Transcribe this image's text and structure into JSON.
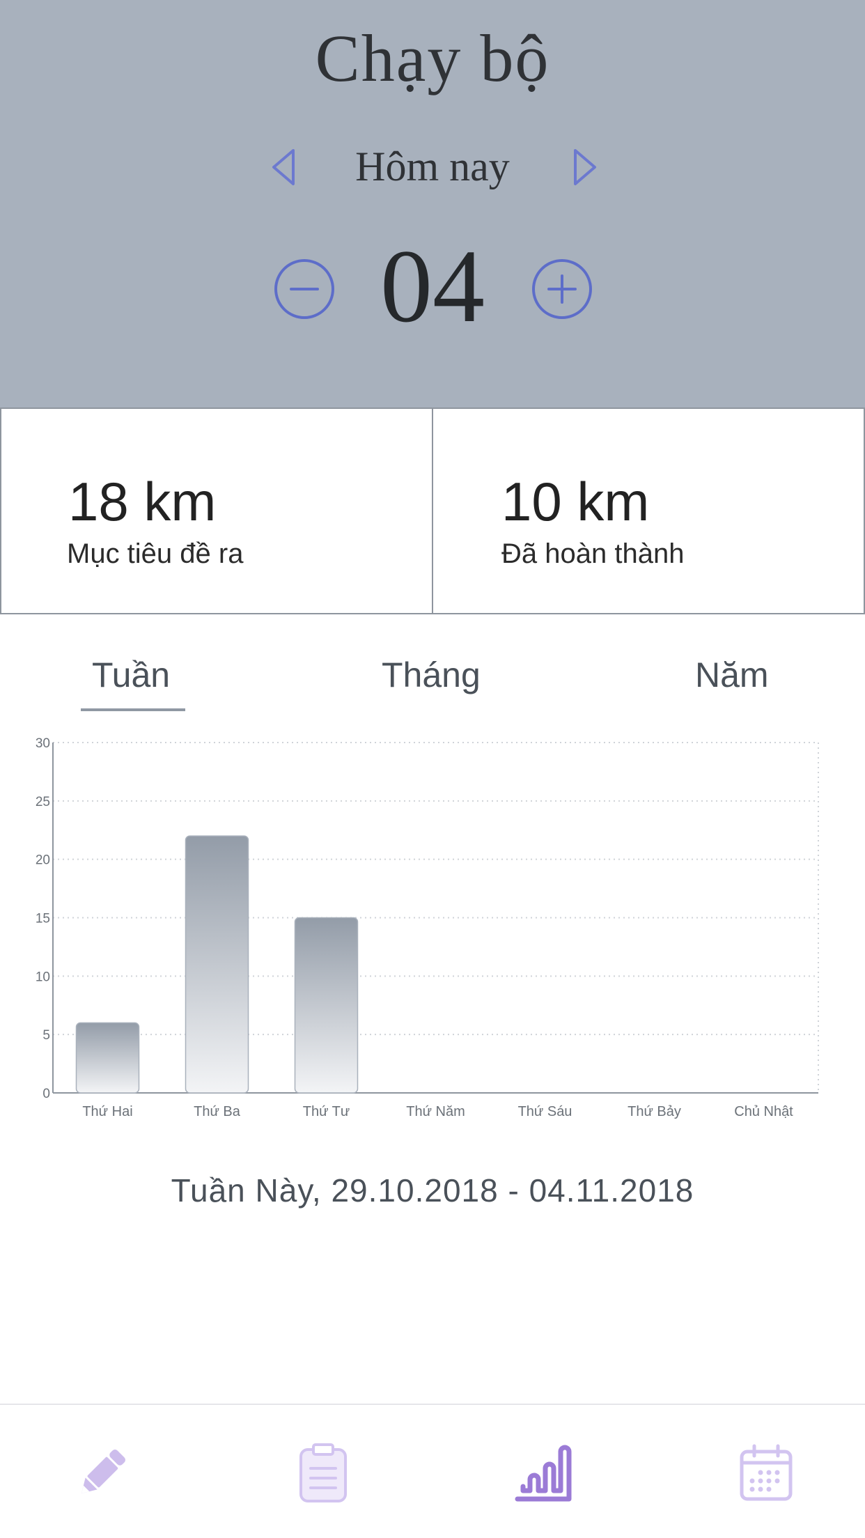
{
  "header": {
    "title": "Chạy bộ",
    "day_label": "Hôm nay",
    "counter": "04"
  },
  "stats": {
    "goal_value": "18 km",
    "goal_label": "Mục tiêu đề ra",
    "done_value": "10 km",
    "done_label": "Đã hoàn thành"
  },
  "tabs": {
    "week": "Tuần",
    "month": "Tháng",
    "year": "Năm",
    "active": "week"
  },
  "chart_data": {
    "type": "bar",
    "categories": [
      "Thứ Hai",
      "Thứ Ba",
      "Thứ Tư",
      "Thứ Năm",
      "Thứ Sáu",
      "Thứ Bảy",
      "Chủ Nhật"
    ],
    "values": [
      6,
      22,
      15,
      0,
      0,
      0,
      0
    ],
    "ylim": [
      0,
      30
    ],
    "yticks": [
      0,
      5,
      10,
      15,
      20,
      25,
      30
    ],
    "grid": true,
    "colors": {
      "bar_top": "#939ca8",
      "bar_bottom": "#f3f4f6",
      "grid": "#cfd3d8",
      "axis": "#8e959e"
    }
  },
  "period_text": "Tuần Này, 29.10.2018 - 04.11.2018",
  "bottom_nav": {
    "items": [
      "pencil-icon",
      "clipboard-icon",
      "chart-icon",
      "calendar-icon"
    ],
    "active": "chart-icon"
  },
  "colors": {
    "header_bg": "#a8b1bd",
    "accent_blue": "#5d6dc9",
    "nav_purple": "#9b7bd6",
    "nav_purple_light": "#cfc0ee"
  }
}
